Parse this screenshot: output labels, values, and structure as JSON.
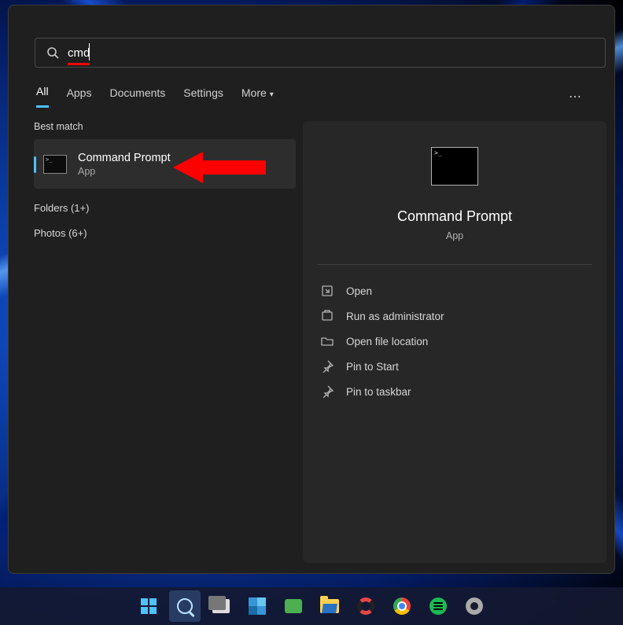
{
  "search": {
    "value": "cmd"
  },
  "tabs": [
    "All",
    "Apps",
    "Documents",
    "Settings",
    "More"
  ],
  "sections": {
    "best_match_label": "Best match",
    "best_match": {
      "title": "Command Prompt",
      "subtitle": "App"
    },
    "categories": [
      "Folders (1+)",
      "Photos (6+)"
    ]
  },
  "details": {
    "title": "Command Prompt",
    "subtitle": "App",
    "actions": [
      "Open",
      "Run as administrator",
      "Open file location",
      "Pin to Start",
      "Pin to taskbar"
    ]
  }
}
